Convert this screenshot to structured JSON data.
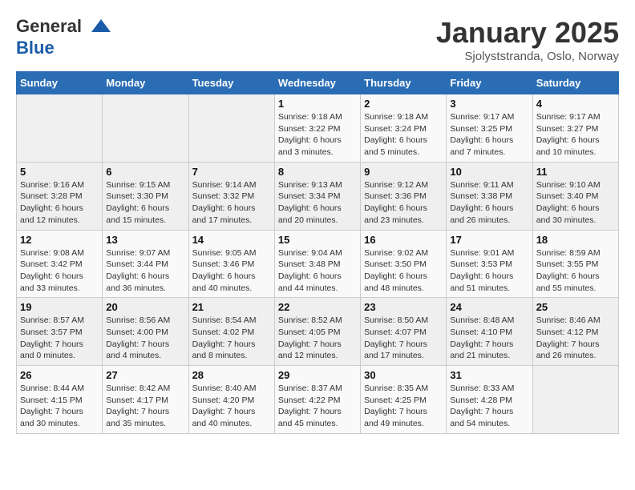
{
  "header": {
    "logo_line1": "General",
    "logo_line2": "Blue",
    "month": "January 2025",
    "location": "Sjolyststranda, Oslo, Norway"
  },
  "weekdays": [
    "Sunday",
    "Monday",
    "Tuesday",
    "Wednesday",
    "Thursday",
    "Friday",
    "Saturday"
  ],
  "weeks": [
    [
      {
        "day": "",
        "info": ""
      },
      {
        "day": "",
        "info": ""
      },
      {
        "day": "",
        "info": ""
      },
      {
        "day": "1",
        "info": "Sunrise: 9:18 AM\nSunset: 3:22 PM\nDaylight: 6 hours and 3 minutes."
      },
      {
        "day": "2",
        "info": "Sunrise: 9:18 AM\nSunset: 3:24 PM\nDaylight: 6 hours and 5 minutes."
      },
      {
        "day": "3",
        "info": "Sunrise: 9:17 AM\nSunset: 3:25 PM\nDaylight: 6 hours and 7 minutes."
      },
      {
        "day": "4",
        "info": "Sunrise: 9:17 AM\nSunset: 3:27 PM\nDaylight: 6 hours and 10 minutes."
      }
    ],
    [
      {
        "day": "5",
        "info": "Sunrise: 9:16 AM\nSunset: 3:28 PM\nDaylight: 6 hours and 12 minutes."
      },
      {
        "day": "6",
        "info": "Sunrise: 9:15 AM\nSunset: 3:30 PM\nDaylight: 6 hours and 15 minutes."
      },
      {
        "day": "7",
        "info": "Sunrise: 9:14 AM\nSunset: 3:32 PM\nDaylight: 6 hours and 17 minutes."
      },
      {
        "day": "8",
        "info": "Sunrise: 9:13 AM\nSunset: 3:34 PM\nDaylight: 6 hours and 20 minutes."
      },
      {
        "day": "9",
        "info": "Sunrise: 9:12 AM\nSunset: 3:36 PM\nDaylight: 6 hours and 23 minutes."
      },
      {
        "day": "10",
        "info": "Sunrise: 9:11 AM\nSunset: 3:38 PM\nDaylight: 6 hours and 26 minutes."
      },
      {
        "day": "11",
        "info": "Sunrise: 9:10 AM\nSunset: 3:40 PM\nDaylight: 6 hours and 30 minutes."
      }
    ],
    [
      {
        "day": "12",
        "info": "Sunrise: 9:08 AM\nSunset: 3:42 PM\nDaylight: 6 hours and 33 minutes."
      },
      {
        "day": "13",
        "info": "Sunrise: 9:07 AM\nSunset: 3:44 PM\nDaylight: 6 hours and 36 minutes."
      },
      {
        "day": "14",
        "info": "Sunrise: 9:05 AM\nSunset: 3:46 PM\nDaylight: 6 hours and 40 minutes."
      },
      {
        "day": "15",
        "info": "Sunrise: 9:04 AM\nSunset: 3:48 PM\nDaylight: 6 hours and 44 minutes."
      },
      {
        "day": "16",
        "info": "Sunrise: 9:02 AM\nSunset: 3:50 PM\nDaylight: 6 hours and 48 minutes."
      },
      {
        "day": "17",
        "info": "Sunrise: 9:01 AM\nSunset: 3:53 PM\nDaylight: 6 hours and 51 minutes."
      },
      {
        "day": "18",
        "info": "Sunrise: 8:59 AM\nSunset: 3:55 PM\nDaylight: 6 hours and 55 minutes."
      }
    ],
    [
      {
        "day": "19",
        "info": "Sunrise: 8:57 AM\nSunset: 3:57 PM\nDaylight: 7 hours and 0 minutes."
      },
      {
        "day": "20",
        "info": "Sunrise: 8:56 AM\nSunset: 4:00 PM\nDaylight: 7 hours and 4 minutes."
      },
      {
        "day": "21",
        "info": "Sunrise: 8:54 AM\nSunset: 4:02 PM\nDaylight: 7 hours and 8 minutes."
      },
      {
        "day": "22",
        "info": "Sunrise: 8:52 AM\nSunset: 4:05 PM\nDaylight: 7 hours and 12 minutes."
      },
      {
        "day": "23",
        "info": "Sunrise: 8:50 AM\nSunset: 4:07 PM\nDaylight: 7 hours and 17 minutes."
      },
      {
        "day": "24",
        "info": "Sunrise: 8:48 AM\nSunset: 4:10 PM\nDaylight: 7 hours and 21 minutes."
      },
      {
        "day": "25",
        "info": "Sunrise: 8:46 AM\nSunset: 4:12 PM\nDaylight: 7 hours and 26 minutes."
      }
    ],
    [
      {
        "day": "26",
        "info": "Sunrise: 8:44 AM\nSunset: 4:15 PM\nDaylight: 7 hours and 30 minutes."
      },
      {
        "day": "27",
        "info": "Sunrise: 8:42 AM\nSunset: 4:17 PM\nDaylight: 7 hours and 35 minutes."
      },
      {
        "day": "28",
        "info": "Sunrise: 8:40 AM\nSunset: 4:20 PM\nDaylight: 7 hours and 40 minutes."
      },
      {
        "day": "29",
        "info": "Sunrise: 8:37 AM\nSunset: 4:22 PM\nDaylight: 7 hours and 45 minutes."
      },
      {
        "day": "30",
        "info": "Sunrise: 8:35 AM\nSunset: 4:25 PM\nDaylight: 7 hours and 49 minutes."
      },
      {
        "day": "31",
        "info": "Sunrise: 8:33 AM\nSunset: 4:28 PM\nDaylight: 7 hours and 54 minutes."
      },
      {
        "day": "",
        "info": ""
      }
    ]
  ]
}
